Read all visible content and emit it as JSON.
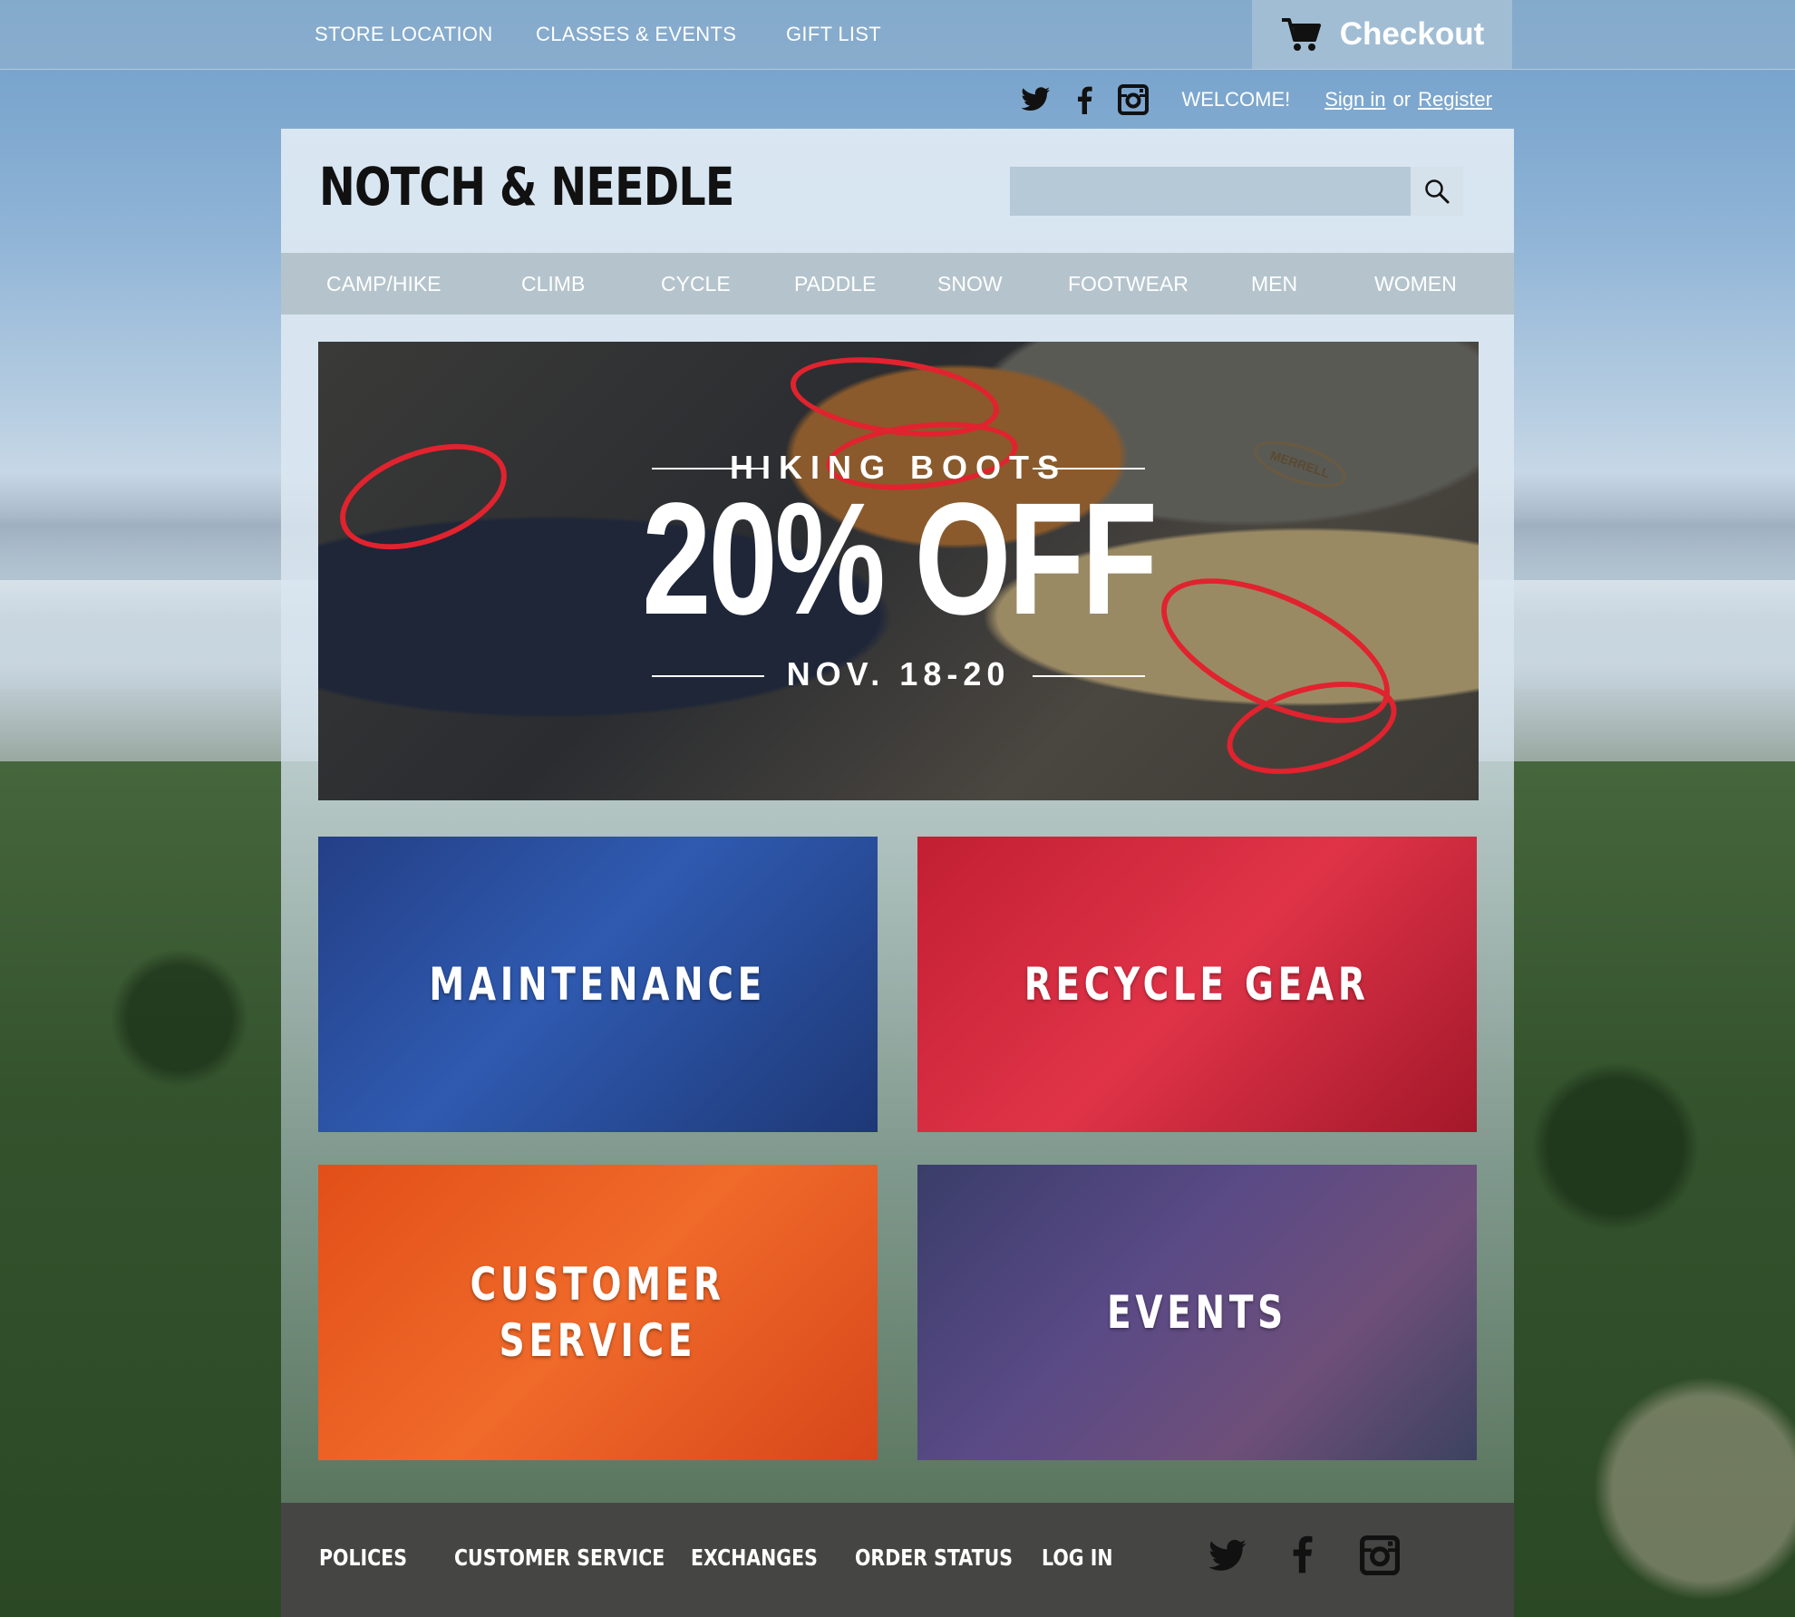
{
  "top_nav": {
    "items": [
      "STORE LOCATION",
      "CLASSES & EVENTS",
      "GIFT LIST"
    ],
    "checkout_label": "Checkout"
  },
  "account": {
    "welcome": "WELCOME!",
    "sign_in": "Sign in",
    "or": "or",
    "register": "Register"
  },
  "brand": {
    "logo": "NOTCH & NEEDLE"
  },
  "search": {
    "placeholder": ""
  },
  "categories": [
    "CAMP/HIKE",
    "CLIMB",
    "CYCLE",
    "PADDLE",
    "SNOW",
    "FOOTWEAR",
    "MEN",
    "WOMEN"
  ],
  "hero": {
    "eyebrow": "HIKING BOOTS",
    "headline": "20% OFF",
    "dates": "NOV. 18-20",
    "boot_brand": "MERRELL"
  },
  "tiles": [
    {
      "label": "MAINTENANCE",
      "color": "#2a4f9a"
    },
    {
      "label": "RECYCLE GEAR",
      "color": "#d42a3c"
    },
    {
      "label_line1": "CUSTOMER",
      "label_line2": "SERVICE",
      "color": "#e5561f"
    },
    {
      "label": "EVENTS",
      "color": "#4a4a7a"
    }
  ],
  "footer": {
    "links": [
      "POLICES",
      "CUSTOMER SERVICE",
      "EXCHANGES",
      "ORDER STATUS",
      "LOG IN"
    ]
  },
  "icons": [
    "cart-icon",
    "twitter-icon",
    "facebook-icon",
    "instagram-icon",
    "search-icon"
  ]
}
